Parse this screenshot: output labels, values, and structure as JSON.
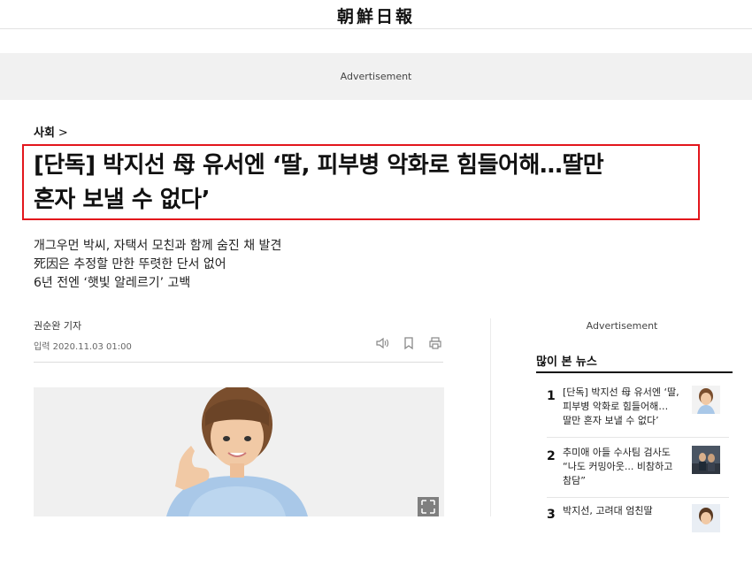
{
  "header": {
    "logo_text": "朝鮮日報"
  },
  "ad_band": {
    "label": "Advertisement"
  },
  "article": {
    "section": "사회",
    "section_chevron": ">",
    "headline_line1": "[단독] 박지선 母 유서엔 ‘딸, 피부병 악화로 힘들어해…딸만",
    "headline_line2": "혼자 보낼 수 없다’",
    "subheads": [
      "개그우먼 박씨, 자택서 모친과 함께 숨진 채 발견",
      "死因은 추정할 만한 뚜렷한 단서 없어",
      "6년 전엔 ‘햇빛 알레르기’ 고백"
    ],
    "author": "권순완 기자",
    "date": "입력 2020.11.03 01:00",
    "tools": [
      "speaker-icon",
      "bookmark-icon",
      "print-icon"
    ]
  },
  "sidebar": {
    "ad_label": "Advertisement",
    "popular_title": "많이 본 뉴스",
    "items": [
      {
        "num": "1",
        "lines": [
          "[단독] 박지선 母 유서엔 ‘딸,",
          "피부병 악화로 힘들어해…",
          "딸만 혼자 보낼 수 없다’"
        ]
      },
      {
        "num": "2",
        "lines": [
          "추미애 아들 수사팀 검사도",
          "“나도 커밍아웃... 비참하고",
          "참담”"
        ]
      },
      {
        "num": "3",
        "lines": [
          "박지선, 고려대 엄친딸"
        ]
      }
    ]
  }
}
